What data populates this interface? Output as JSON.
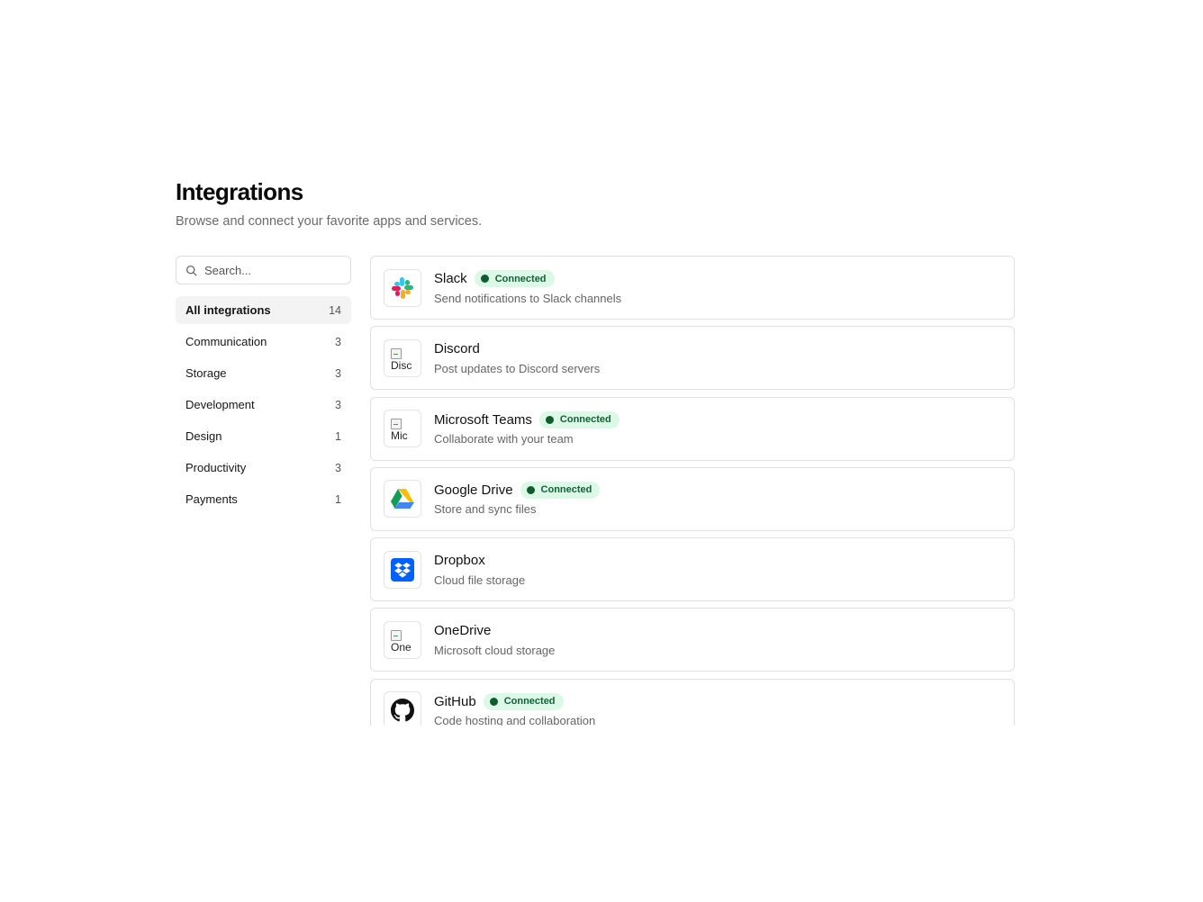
{
  "header": {
    "title": "Integrations",
    "subtitle": "Browse and connect your favorite apps and services."
  },
  "search": {
    "placeholder": "Search...",
    "value": ""
  },
  "categories": [
    {
      "label": "All integrations",
      "count": "14",
      "active": true
    },
    {
      "label": "Communication",
      "count": "3"
    },
    {
      "label": "Storage",
      "count": "3"
    },
    {
      "label": "Development",
      "count": "3"
    },
    {
      "label": "Design",
      "count": "1"
    },
    {
      "label": "Productivity",
      "count": "3"
    },
    {
      "label": "Payments",
      "count": "1"
    }
  ],
  "integrations": [
    {
      "name": "Slack",
      "description": "Send notifications to Slack channels",
      "status": "Connected",
      "icon": "slack-icon"
    },
    {
      "name": "Discord",
      "description": "Post updates to Discord servers",
      "status": "",
      "icon": "broken-image-icon",
      "alt": "Disc"
    },
    {
      "name": "Microsoft Teams",
      "description": "Collaborate with your team",
      "status": "Connected",
      "icon": "broken-image-icon",
      "alt": "Mic"
    },
    {
      "name": "Google Drive",
      "description": "Store and sync files",
      "status": "Connected",
      "icon": "google-drive-icon"
    },
    {
      "name": "Dropbox",
      "description": "Cloud file storage",
      "status": "",
      "icon": "dropbox-icon"
    },
    {
      "name": "OneDrive",
      "description": "Microsoft cloud storage",
      "status": "",
      "icon": "broken-image-icon",
      "alt": "One"
    },
    {
      "name": "GitHub",
      "description": "Code hosting and collaboration",
      "status": "Connected",
      "icon": "github-icon"
    }
  ],
  "colors": {
    "badge_bg": "#dcf8e6",
    "badge_text": "#14603a",
    "active_category_bg": "#f3f3f3",
    "border": "#e1e1e1",
    "dropbox_blue": "#0061fe"
  }
}
